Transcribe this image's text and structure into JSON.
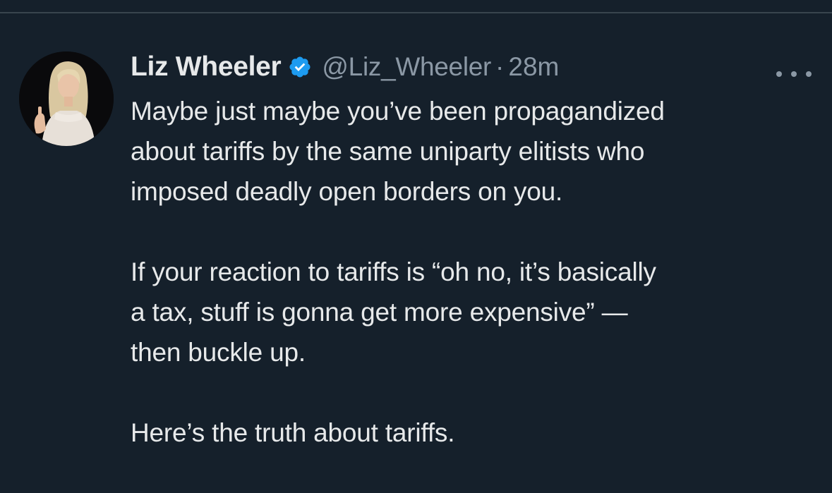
{
  "tweet": {
    "author": {
      "display_name": "Liz Wheeler",
      "handle": "@Liz_Wheeler",
      "verified": true,
      "verified_icon": "verified-badge-icon",
      "verified_color": "#1d9bf0"
    },
    "separator": "·",
    "timestamp": "28m",
    "more_icon": "more-options-icon",
    "paragraphs": [
      {
        "lines": [
          "Maybe just maybe you’ve been propagandized",
          "about tariffs by the same uniparty elitists who",
          "imposed deadly open borders on you."
        ]
      },
      {
        "lines": [
          "If your reaction to tariffs is “oh no, it’s basically",
          "a tax, stuff is gonna get more expensive” —",
          "then buckle up."
        ]
      },
      {
        "lines": [
          "Here’s the truth about tariffs."
        ]
      }
    ]
  },
  "colors": {
    "background": "#15202b",
    "text_primary": "#e7e9ea",
    "text_secondary": "#8b98a5",
    "divider": "#38444d"
  }
}
